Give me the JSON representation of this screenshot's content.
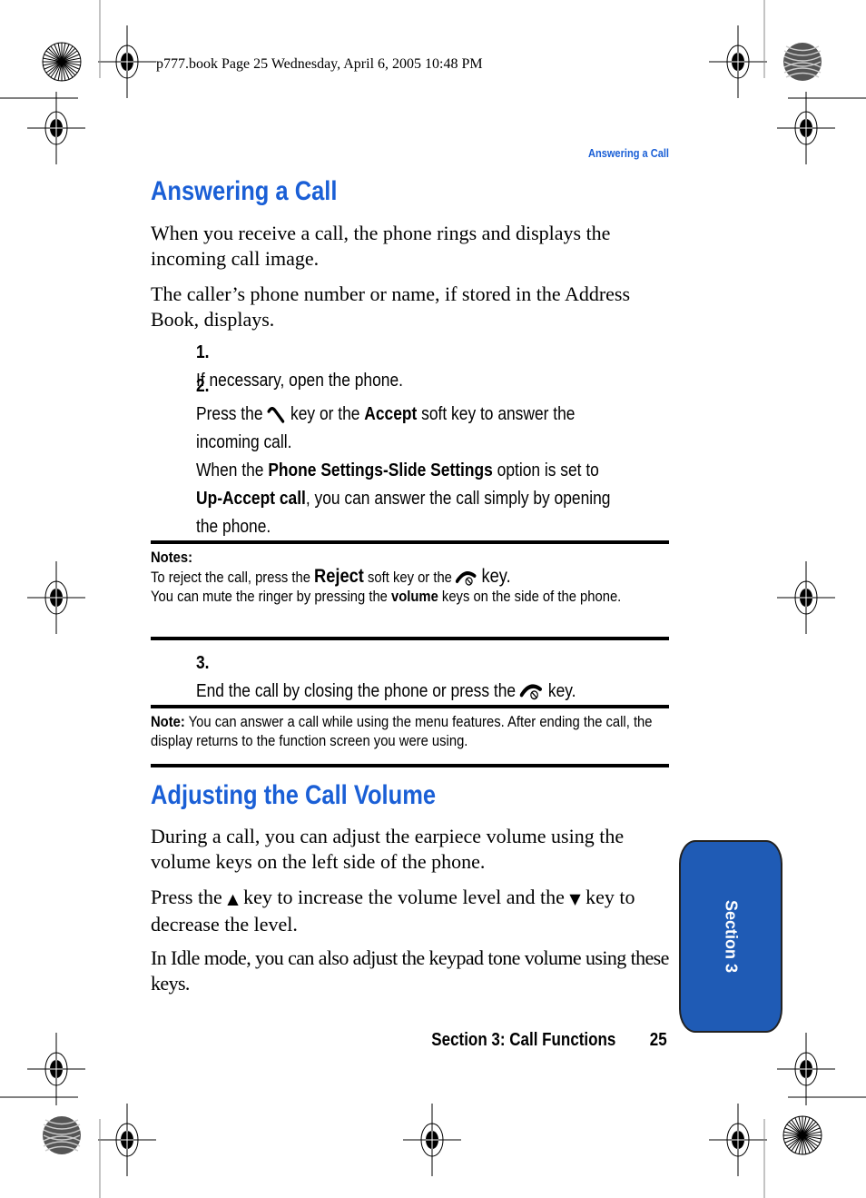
{
  "print_header": "p777.book  Page 25  Wednesday, April 6, 2005  10:48 PM",
  "running_head": "Answering a Call",
  "section1": {
    "title": "Answering a Call",
    "para1": "When you receive a call, the phone rings and displays the incoming call image.",
    "para2": "The caller’s phone number or name, if stored in the Address Book, displays.",
    "steps": [
      {
        "num": "1.",
        "text": "If necessary, open the phone."
      },
      {
        "num": "2.",
        "pre": "Press the",
        "icon": "send-key-icon",
        "mid": "key or the",
        "bold1": "Accept",
        "post": "soft key to answer the incoming call.",
        "sub_pre": "When the",
        "sub_bold1": "Phone Settings-Slide Settings",
        "sub_mid": "option is set to",
        "sub_bold2": "Up-Accept call",
        "sub_post": ",  you can answer the call simply by opening the phone."
      },
      {
        "num": "3.",
        "pre": "End the call by closing the phone or press the",
        "icon": "end-key-icon",
        "post": "key."
      }
    ],
    "notes": {
      "label": "Notes:",
      "line1_pre": "To reject the call, press the",
      "line1_bold": "Reject",
      "line1_mid": "soft key or the",
      "line1_post": "key.",
      "line2_pre": "You can mute the ringer by pressing the",
      "line2_bold": "volume",
      "line2_post": "keys on the side of the phone."
    },
    "note": {
      "label": "Note:",
      "text": "You can answer a call while using the menu features. After ending the call, the display returns to the function screen you were using."
    }
  },
  "section2": {
    "title": "Adjusting the Call Volume",
    "para1": "During a call, you can adjust the earpiece volume using the volume keys on the left side of the phone.",
    "para2_pre": "Press the",
    "up_symbol": "▲",
    "para2_mid": "key to increase the volume level and the",
    "down_symbol": "▼",
    "para2_post": "key to decrease the level.",
    "para3": "In Idle mode, you can also adjust the keypad tone volume using these keys."
  },
  "side_tab": {
    "label": "Section 3",
    "color": "#1f5bb5"
  },
  "footer": {
    "section": "Section 3: Call Functions",
    "page": "25"
  },
  "colors": {
    "heading": "#1a5fd6"
  }
}
